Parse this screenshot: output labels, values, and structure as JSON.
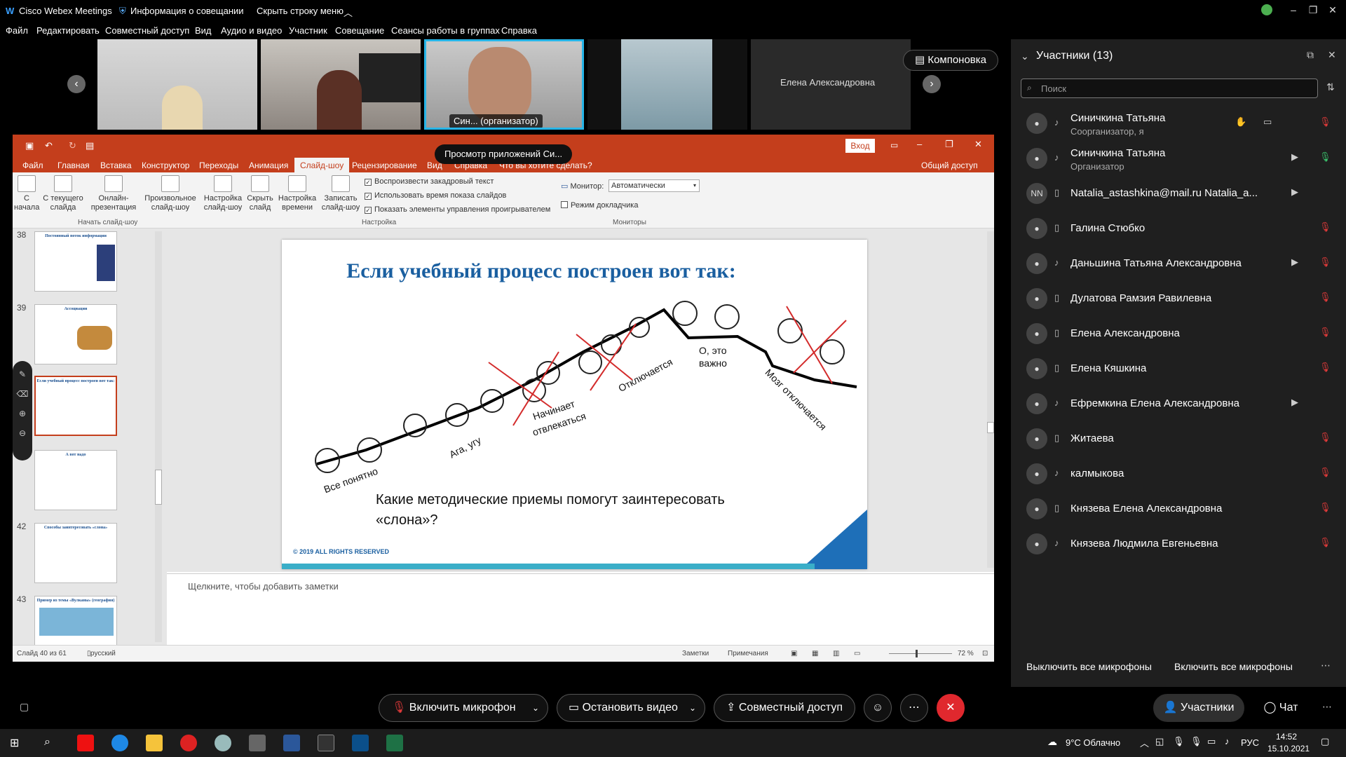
{
  "titlebar": {
    "app_name": "Cisco Webex Meetings",
    "meeting_info": "Информация о совещании",
    "hide_menu": "Скрыть строку меню"
  },
  "menu": [
    "Файл",
    "Редактировать",
    "Совместный доступ",
    "Вид",
    "Аудио и видео",
    "Участник",
    "Совещание",
    "Сеансы работы в группах",
    "Справка"
  ],
  "videos": {
    "organizer_label": "Син... (организатор)",
    "name_tile": "Елена Александровна",
    "layout_button": "Компоновка"
  },
  "ppt": {
    "sign_in": "Вход",
    "sharing_tooltip": "Просмотр приложений Си...",
    "tabs": [
      "Файл",
      "Главная",
      "Вставка",
      "Конструктор",
      "Переходы",
      "Анимация",
      "Слайд-шоу",
      "Рецензирование",
      "Вид",
      "Справка"
    ],
    "tell_me": "Что вы хотите сделать?",
    "share": "Общий доступ",
    "ribbon": {
      "from_start": [
        "С",
        "начала"
      ],
      "from_current": [
        "С текущего",
        "слайда"
      ],
      "online": [
        "Онлайн-",
        "презентация"
      ],
      "custom": [
        "Произвольное",
        "слайд-шоу"
      ],
      "group_start": "Начать слайд-шоу",
      "setup": [
        "Настройка",
        "слайд-шоу"
      ],
      "hide": [
        "Скрыть",
        "слайд"
      ],
      "timing": [
        "Настройка",
        "времени"
      ],
      "record": [
        "Записать",
        "слайд-шоу"
      ],
      "chk1": "Воспроизвести закадровый текст",
      "chk2": "Использовать время показа слайдов",
      "chk3": "Показать элементы управления проигрывателем",
      "group_setup": "Настройка",
      "monitor_label": "Монитор:",
      "monitor_value": "Автоматически",
      "presenter_view": "Режим докладчика",
      "group_monitors": "Мониторы"
    },
    "slide_numbers": [
      "38",
      "39",
      "40",
      "41",
      "42",
      "43"
    ],
    "thumb_titles": [
      "Постоянный поток информации",
      "Ассоциации",
      "Если учебный процесс построен вот так:",
      "А вот надо",
      "Способы заинтересовать «слона»",
      "Пример из темы «Вулканы» (география)"
    ],
    "slide": {
      "title": "Если учебный процесс  построен  вот так:",
      "labels": [
        "Все понятно",
        "Ага, угу",
        "Начинает",
        "отвлекаться",
        "Отключается",
        "О, это",
        "важно",
        "Мозг отключается"
      ],
      "question_line1": "Какие методические приемы  помогут   заинтересовать",
      "question_line2": "«слона»?",
      "footer": "© 2019 ALL RIGHTS RESERVED"
    },
    "notes_placeholder": "Щелкните, чтобы добавить заметки",
    "status": {
      "slide_of": "Слайд 40 из 61",
      "language": "русский",
      "notes": "Заметки",
      "comments": "Примечания",
      "zoom": "72 %"
    }
  },
  "panel": {
    "title": "Участники (13)",
    "search_placeholder": "Поиск",
    "participants": [
      {
        "name": "Синичкина Татьяна",
        "role": "Соорганизатор, я"
      },
      {
        "name": "Синичкина Татьяна",
        "role": "Организатор"
      },
      {
        "name": "Natalia_astashkina@mail.ru Natalia_a...",
        "role": "",
        "initials": "NN"
      },
      {
        "name": "Галина Стюбко",
        "role": ""
      },
      {
        "name": "Даньшина Татьяна Александровна",
        "role": ""
      },
      {
        "name": "Дулатова Рамзия Равилевна",
        "role": ""
      },
      {
        "name": "Елена Александровна",
        "role": ""
      },
      {
        "name": "Елена Кяшкина",
        "role": ""
      },
      {
        "name": "Ефремкина Елена Александровна",
        "role": ""
      },
      {
        "name": "Житаева",
        "role": ""
      },
      {
        "name": "калмыкова",
        "role": ""
      },
      {
        "name": "Князева Елена Александровна",
        "role": ""
      },
      {
        "name": "Князева Людмила Евгеньевна",
        "role": ""
      }
    ],
    "mute_all": "Выключить все микрофоны",
    "unmute_all": "Включить все микрофоны"
  },
  "controls": {
    "mic": "Включить микрофон",
    "video": "Остановить видео",
    "share": "Совместный доступ",
    "participants": "Участники",
    "chat": "Чат"
  },
  "taskbar": {
    "weather": "9°C  Облачно",
    "lang": "РУС",
    "time": "14:52",
    "date": "15.10.2021"
  },
  "colors": {
    "ppt_accent": "#c43e1c",
    "webex_end": "#e0282e",
    "slide_title": "#1a5fa0"
  }
}
